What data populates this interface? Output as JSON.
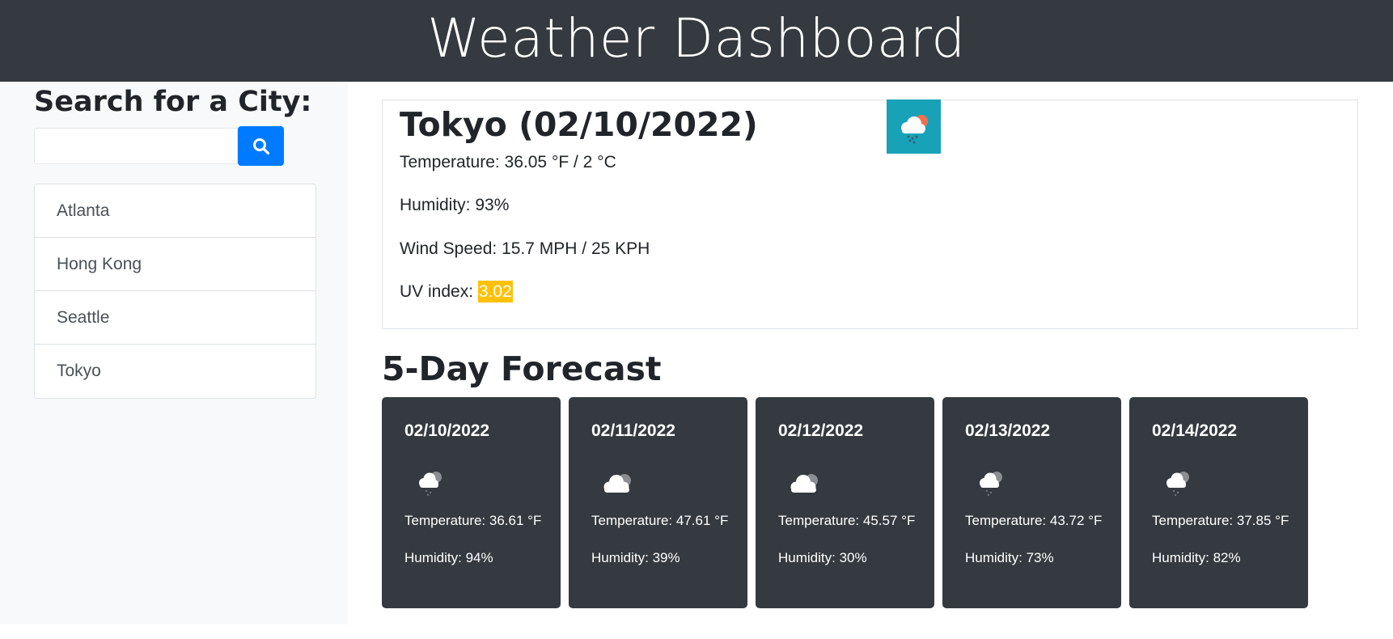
{
  "header": {
    "title": "Weather Dashboard"
  },
  "sidebar": {
    "heading": "Search for a City:",
    "search": {
      "value": "",
      "placeholder": "",
      "button_icon": "search-icon"
    },
    "cities": [
      "Atlanta",
      "Hong Kong",
      "Seattle",
      "Tokyo"
    ]
  },
  "current": {
    "title": "Tokyo (02/10/2022)",
    "icon": "rain-cloud-sun-icon",
    "temperature": "Temperature: 36.05 °F / 2 °C",
    "humidity": "Humidity: 93%",
    "wind": "Wind Speed: 15.7 MPH / 25 KPH",
    "uv_label": "UV index: ",
    "uv_value": "3.02",
    "uv_color": "#ffc107"
  },
  "forecast": {
    "heading": "5-Day Forecast",
    "days": [
      {
        "date": "02/10/2022",
        "icon": "rain-cloud-icon",
        "temp": "Temperature: 36.61 °F",
        "humidity": "Humidity: 94%"
      },
      {
        "date": "02/11/2022",
        "icon": "cloud-icon",
        "temp": "Temperature: 47.61 °F",
        "humidity": "Humidity: 39%"
      },
      {
        "date": "02/12/2022",
        "icon": "cloud-icon",
        "temp": "Temperature: 45.57 °F",
        "humidity": "Humidity: 30%"
      },
      {
        "date": "02/13/2022",
        "icon": "rain-cloud-icon",
        "temp": "Temperature: 43.72 °F",
        "humidity": "Humidity: 73%"
      },
      {
        "date": "02/14/2022",
        "icon": "rain-cloud-icon",
        "temp": "Temperature: 37.85 °F",
        "humidity": "Humidity: 82%"
      }
    ]
  },
  "colors": {
    "header_bg": "#343a40",
    "sidebar_bg": "#f8f9fa",
    "accent_button": "#007bff",
    "icon_tile": "#17a2b8",
    "card_bg": "#343a40"
  }
}
